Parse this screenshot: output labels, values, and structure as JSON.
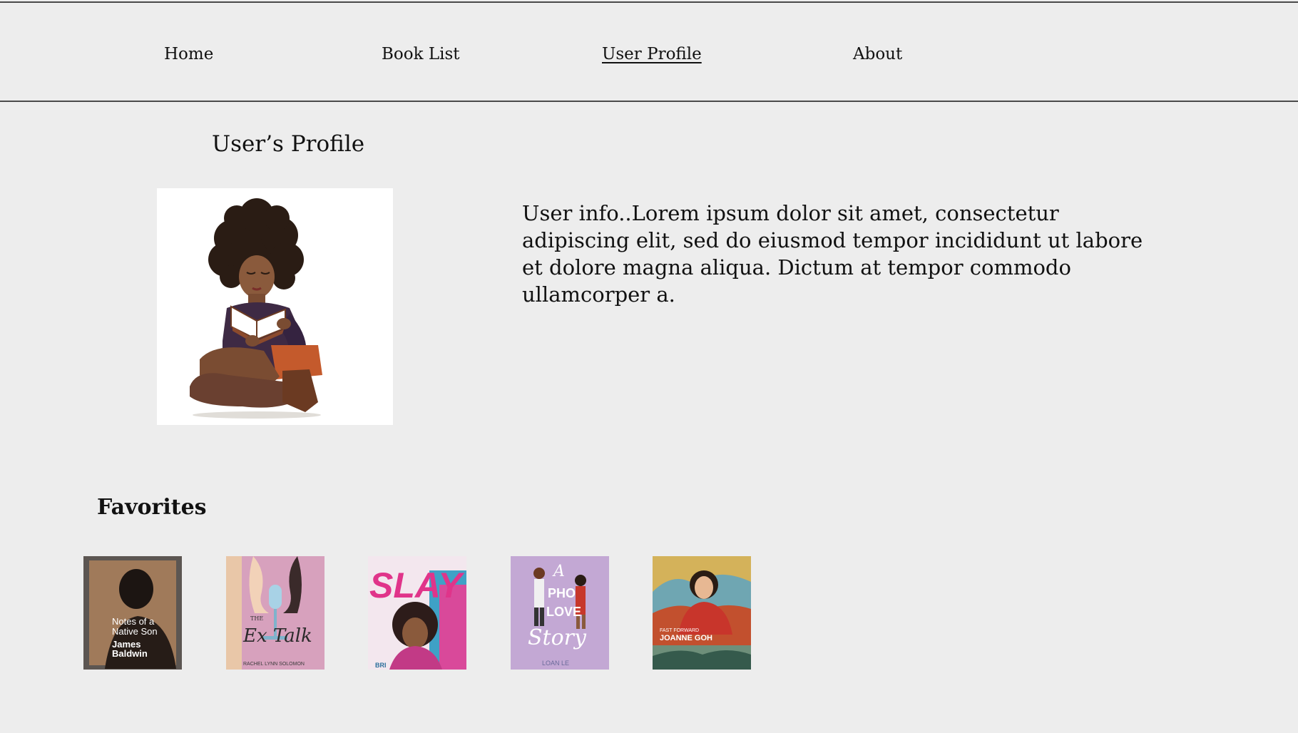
{
  "nav": {
    "items": [
      {
        "label": "Home",
        "active": false
      },
      {
        "label": "Book List",
        "active": false
      },
      {
        "label": "User Profile",
        "active": true
      },
      {
        "label": "About",
        "active": false
      }
    ]
  },
  "profile": {
    "title": "User’s Profile",
    "avatar_icon": "reading-woman-illustration",
    "info": "User info..Lorem ipsum dolor sit amet, consectetur adipiscing elit, sed do eiusmod tempor incididunt ut labore et dolore magna aliqua. Dictum at tempor commodo ullamcorper a."
  },
  "favorites": {
    "title": "Favorites",
    "books": [
      {
        "title_line1": "Notes of a",
        "title_line2": "Native Son",
        "author_line1": "James",
        "author_line2": "Baldwin"
      },
      {
        "pre": "THE",
        "title": "Ex Talk",
        "author": "RACHEL LYNN SOLOMON"
      },
      {
        "title": "SLAY",
        "author": "BRI"
      },
      {
        "title_line1": "A",
        "title_line2": "PHO",
        "title_line3": "LOVE",
        "title_line4": "Story",
        "author": "LOAN LE"
      },
      {
        "pre": "FAST FORWARD",
        "author": "JOANNE GOH"
      }
    ]
  },
  "colors": {
    "background": "#ededed",
    "rule": "#4a4a4a"
  }
}
